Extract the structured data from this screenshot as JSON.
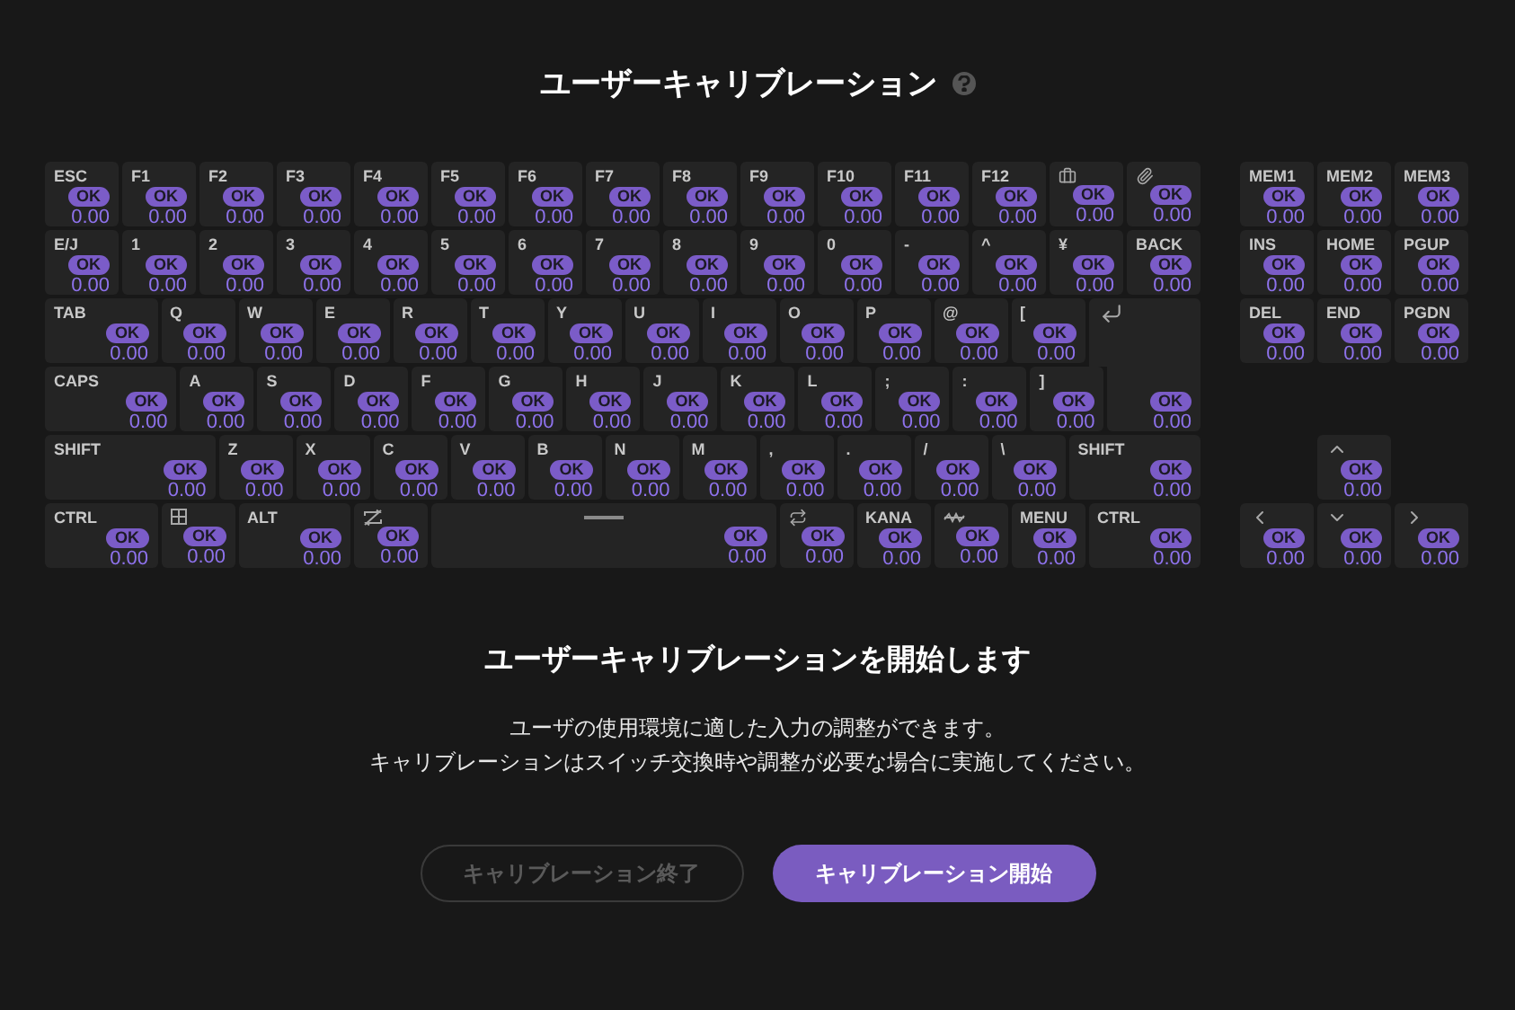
{
  "title": "ユーザーキャリブレーション",
  "keyboard": {
    "rows": [
      {
        "keys": [
          {
            "kind": "text",
            "label": "ESC",
            "status": "OK",
            "value": "0.00"
          },
          {
            "kind": "text",
            "label": "F1",
            "status": "OK",
            "value": "0.00"
          },
          {
            "kind": "text",
            "label": "F2",
            "status": "OK",
            "value": "0.00"
          },
          {
            "kind": "text",
            "label": "F3",
            "status": "OK",
            "value": "0.00"
          },
          {
            "kind": "text",
            "label": "F4",
            "status": "OK",
            "value": "0.00"
          },
          {
            "kind": "text",
            "label": "F5",
            "status": "OK",
            "value": "0.00"
          },
          {
            "kind": "text",
            "label": "F6",
            "status": "OK",
            "value": "0.00"
          },
          {
            "kind": "text",
            "label": "F7",
            "status": "OK",
            "value": "0.00"
          },
          {
            "kind": "text",
            "label": "F8",
            "status": "OK",
            "value": "0.00"
          },
          {
            "kind": "text",
            "label": "F9",
            "status": "OK",
            "value": "0.00"
          },
          {
            "kind": "text",
            "label": "F10",
            "status": "OK",
            "value": "0.00"
          },
          {
            "kind": "text",
            "label": "F11",
            "status": "OK",
            "value": "0.00"
          },
          {
            "kind": "text",
            "label": "F12",
            "status": "OK",
            "value": "0.00"
          },
          {
            "kind": "briefcase",
            "status": "OK",
            "value": "0.00"
          },
          {
            "kind": "clip",
            "status": "OK",
            "value": "0.00"
          }
        ]
      },
      {
        "keys": [
          {
            "kind": "text",
            "label": "E/J",
            "status": "OK",
            "value": "0.00"
          },
          {
            "kind": "text",
            "label": "1",
            "status": "OK",
            "value": "0.00"
          },
          {
            "kind": "text",
            "label": "2",
            "status": "OK",
            "value": "0.00"
          },
          {
            "kind": "text",
            "label": "3",
            "status": "OK",
            "value": "0.00"
          },
          {
            "kind": "text",
            "label": "4",
            "status": "OK",
            "value": "0.00"
          },
          {
            "kind": "text",
            "label": "5",
            "status": "OK",
            "value": "0.00"
          },
          {
            "kind": "text",
            "label": "6",
            "status": "OK",
            "value": "0.00"
          },
          {
            "kind": "text",
            "label": "7",
            "status": "OK",
            "value": "0.00"
          },
          {
            "kind": "text",
            "label": "8",
            "status": "OK",
            "value": "0.00"
          },
          {
            "kind": "text",
            "label": "9",
            "status": "OK",
            "value": "0.00"
          },
          {
            "kind": "text",
            "label": "0",
            "status": "OK",
            "value": "0.00"
          },
          {
            "kind": "text",
            "label": "-",
            "status": "OK",
            "value": "0.00"
          },
          {
            "kind": "text",
            "label": "^",
            "status": "OK",
            "value": "0.00"
          },
          {
            "kind": "text",
            "label": "¥",
            "status": "OK",
            "value": "0.00"
          },
          {
            "kind": "text",
            "label": "BACK",
            "status": "OK",
            "value": "0.00"
          }
        ]
      },
      {
        "keys": [
          {
            "kind": "text",
            "label": "TAB",
            "status": "OK",
            "value": "0.00"
          },
          {
            "kind": "text",
            "label": "Q",
            "status": "OK",
            "value": "0.00"
          },
          {
            "kind": "text",
            "label": "W",
            "status": "OK",
            "value": "0.00"
          },
          {
            "kind": "text",
            "label": "E",
            "status": "OK",
            "value": "0.00"
          },
          {
            "kind": "text",
            "label": "R",
            "status": "OK",
            "value": "0.00"
          },
          {
            "kind": "text",
            "label": "T",
            "status": "OK",
            "value": "0.00"
          },
          {
            "kind": "text",
            "label": "Y",
            "status": "OK",
            "value": "0.00"
          },
          {
            "kind": "text",
            "label": "U",
            "status": "OK",
            "value": "0.00"
          },
          {
            "kind": "text",
            "label": "I",
            "status": "OK",
            "value": "0.00"
          },
          {
            "kind": "text",
            "label": "O",
            "status": "OK",
            "value": "0.00"
          },
          {
            "kind": "text",
            "label": "P",
            "status": "OK",
            "value": "0.00"
          },
          {
            "kind": "text",
            "label": "@",
            "status": "OK",
            "value": "0.00"
          },
          {
            "kind": "text",
            "label": "[",
            "status": "OK",
            "value": "0.00"
          },
          {
            "kind": "enter"
          }
        ]
      },
      {
        "keys": [
          {
            "kind": "text",
            "label": "CAPS",
            "status": "OK",
            "value": "0.00"
          },
          {
            "kind": "text",
            "label": "A",
            "status": "OK",
            "value": "0.00"
          },
          {
            "kind": "text",
            "label": "S",
            "status": "OK",
            "value": "0.00"
          },
          {
            "kind": "text",
            "label": "D",
            "status": "OK",
            "value": "0.00"
          },
          {
            "kind": "text",
            "label": "F",
            "status": "OK",
            "value": "0.00"
          },
          {
            "kind": "text",
            "label": "G",
            "status": "OK",
            "value": "0.00"
          },
          {
            "kind": "text",
            "label": "H",
            "status": "OK",
            "value": "0.00"
          },
          {
            "kind": "text",
            "label": "J",
            "status": "OK",
            "value": "0.00"
          },
          {
            "kind": "text",
            "label": "K",
            "status": "OK",
            "value": "0.00"
          },
          {
            "kind": "text",
            "label": "L",
            "status": "OK",
            "value": "0.00"
          },
          {
            "kind": "text",
            "label": ";",
            "status": "OK",
            "value": "0.00"
          },
          {
            "kind": "text",
            "label": ":",
            "status": "OK",
            "value": "0.00"
          },
          {
            "kind": "text",
            "label": "]",
            "status": "OK",
            "value": "0.00"
          },
          {
            "kind": "enter_lower",
            "status": "OK",
            "value": "0.00"
          }
        ]
      },
      {
        "keys": [
          {
            "kind": "text",
            "label": "SHIFT",
            "status": "OK",
            "value": "0.00"
          },
          {
            "kind": "text",
            "label": "Z",
            "status": "OK",
            "value": "0.00"
          },
          {
            "kind": "text",
            "label": "X",
            "status": "OK",
            "value": "0.00"
          },
          {
            "kind": "text",
            "label": "C",
            "status": "OK",
            "value": "0.00"
          },
          {
            "kind": "text",
            "label": "V",
            "status": "OK",
            "value": "0.00"
          },
          {
            "kind": "text",
            "label": "B",
            "status": "OK",
            "value": "0.00"
          },
          {
            "kind": "text",
            "label": "N",
            "status": "OK",
            "value": "0.00"
          },
          {
            "kind": "text",
            "label": "M",
            "status": "OK",
            "value": "0.00"
          },
          {
            "kind": "text",
            "label": ",",
            "status": "OK",
            "value": "0.00"
          },
          {
            "kind": "text",
            "label": ".",
            "status": "OK",
            "value": "0.00"
          },
          {
            "kind": "text",
            "label": "/",
            "status": "OK",
            "value": "0.00"
          },
          {
            "kind": "text",
            "label": "\\",
            "status": "OK",
            "value": "0.00"
          },
          {
            "kind": "text",
            "label": "SHIFT",
            "status": "OK",
            "value": "0.00"
          }
        ]
      },
      {
        "keys": [
          {
            "kind": "text",
            "label": "CTRL",
            "status": "OK",
            "value": "0.00"
          },
          {
            "kind": "window",
            "status": "OK",
            "value": "0.00"
          },
          {
            "kind": "text",
            "label": "ALT",
            "status": "OK",
            "value": "0.00"
          },
          {
            "kind": "nocvt",
            "status": "OK",
            "value": "0.00"
          },
          {
            "kind": "space",
            "status": "OK",
            "value": "0.00"
          },
          {
            "kind": "cvt",
            "status": "OK",
            "value": "0.00"
          },
          {
            "kind": "text",
            "label": "KANA",
            "status": "OK",
            "value": "0.00"
          },
          {
            "kind": "wave",
            "status": "OK",
            "value": "0.00"
          },
          {
            "kind": "text",
            "label": "MENU",
            "status": "OK",
            "value": "0.00"
          },
          {
            "kind": "text",
            "label": "CTRL",
            "status": "OK",
            "value": "0.00"
          }
        ]
      }
    ],
    "nav_rows": [
      [
        {
          "kind": "text",
          "label": "MEM1",
          "status": "OK",
          "value": "0.00"
        },
        {
          "kind": "text",
          "label": "MEM2",
          "status": "OK",
          "value": "0.00"
        },
        {
          "kind": "text",
          "label": "MEM3",
          "status": "OK",
          "value": "0.00"
        }
      ],
      [
        {
          "kind": "text",
          "label": "INS",
          "status": "OK",
          "value": "0.00"
        },
        {
          "kind": "text",
          "label": "HOME",
          "status": "OK",
          "value": "0.00"
        },
        {
          "kind": "text",
          "label": "PGUP",
          "status": "OK",
          "value": "0.00"
        }
      ],
      [
        {
          "kind": "text",
          "label": "DEL",
          "status": "OK",
          "value": "0.00"
        },
        {
          "kind": "text",
          "label": "END",
          "status": "OK",
          "value": "0.00"
        },
        {
          "kind": "text",
          "label": "PGDN",
          "status": "OK",
          "value": "0.00"
        }
      ]
    ],
    "arrow_up": {
      "kind": "up",
      "status": "OK",
      "value": "0.00"
    },
    "arrow_row": [
      {
        "kind": "left",
        "status": "OK",
        "value": "0.00"
      },
      {
        "kind": "down",
        "status": "OK",
        "value": "0.00"
      },
      {
        "kind": "right",
        "status": "OK",
        "value": "0.00"
      }
    ]
  },
  "heading": "ユーザーキャリブレーションを開始します",
  "description": [
    "ユーザの使用環境に適した入力の調整ができます。",
    "キャリブレーションはスイッチ交換時や調整が必要な場合に実施してください。"
  ],
  "buttons": [
    {
      "label": "キャリブレーション終了",
      "disabled": true
    },
    {
      "label": "キャリブレーション開始",
      "disabled": false
    }
  ]
}
